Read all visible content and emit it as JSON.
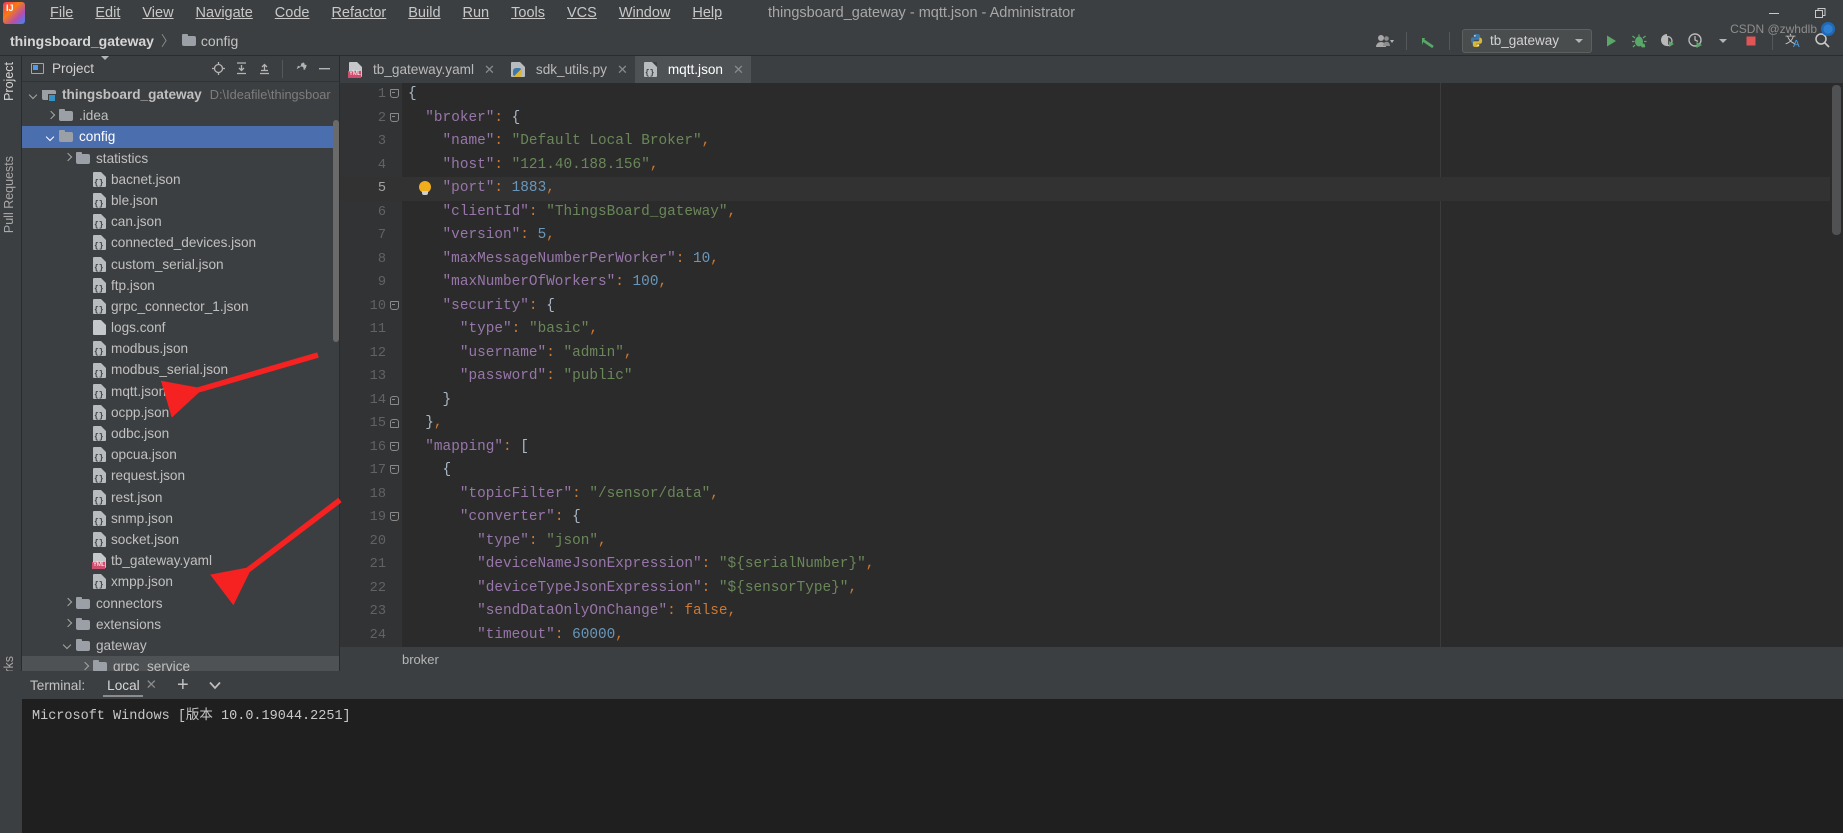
{
  "window": {
    "title": "thingsboard_gateway - mqtt.json - Administrator",
    "minimize": "—",
    "restore": "❐",
    "close": "✕"
  },
  "menubar": {
    "items": [
      "File",
      "Edit",
      "View",
      "Navigate",
      "Code",
      "Refactor",
      "Build",
      "Run",
      "Tools",
      "VCS",
      "Window",
      "Help"
    ]
  },
  "navbar": {
    "breadcrumb": {
      "root": "thingsboard_gateway",
      "separator": "〉",
      "item": "config"
    },
    "run_config": {
      "label": "tb_gateway"
    },
    "icons": {
      "people": "people-icon",
      "updates": "update-project-icon",
      "run": "run-icon",
      "debug": "debug-icon",
      "coverage": "run-with-coverage-icon",
      "profile": "profiler-icon",
      "stop": "stop-icon",
      "translate": "translate-icon",
      "search": "search-everywhere-icon"
    }
  },
  "left_strip": {
    "tabs": [
      "Project",
      "Pull Requests",
      "Bookmarks"
    ]
  },
  "project_panel": {
    "header": {
      "title": "Project",
      "dropdown": "▾"
    },
    "actions": [
      "select-opened-file",
      "expand-all",
      "collapse-all",
      "settings",
      "hide"
    ],
    "tree": [
      {
        "label": "thingsboard_gateway",
        "detail": "D:\\Ideafile\\thingsboar",
        "icon": "module",
        "indent": 0,
        "arrow": "open",
        "bold": true
      },
      {
        "label": ".idea",
        "icon": "folder",
        "indent": 1,
        "arrow": "closed"
      },
      {
        "label": "config",
        "icon": "folder",
        "indent": 1,
        "arrow": "open",
        "selected": true
      },
      {
        "label": "statistics",
        "icon": "folder",
        "indent": 2,
        "arrow": "closed"
      },
      {
        "label": "bacnet.json",
        "icon": "json",
        "indent": 3
      },
      {
        "label": "ble.json",
        "icon": "json",
        "indent": 3
      },
      {
        "label": "can.json",
        "icon": "json",
        "indent": 3
      },
      {
        "label": "connected_devices.json",
        "icon": "json",
        "indent": 3
      },
      {
        "label": "custom_serial.json",
        "icon": "json",
        "indent": 3
      },
      {
        "label": "ftp.json",
        "icon": "json",
        "indent": 3
      },
      {
        "label": "grpc_connector_1.json",
        "icon": "json",
        "indent": 3
      },
      {
        "label": "logs.conf",
        "icon": "conf",
        "indent": 3
      },
      {
        "label": "modbus.json",
        "icon": "json",
        "indent": 3
      },
      {
        "label": "modbus_serial.json",
        "icon": "json",
        "indent": 3
      },
      {
        "label": "mqtt.json",
        "icon": "json",
        "indent": 3
      },
      {
        "label": "ocpp.json",
        "icon": "json",
        "indent": 3
      },
      {
        "label": "odbc.json",
        "icon": "json",
        "indent": 3
      },
      {
        "label": "opcua.json",
        "icon": "json",
        "indent": 3
      },
      {
        "label": "request.json",
        "icon": "json",
        "indent": 3
      },
      {
        "label": "rest.json",
        "icon": "json",
        "indent": 3
      },
      {
        "label": "snmp.json",
        "icon": "json",
        "indent": 3
      },
      {
        "label": "socket.json",
        "icon": "json",
        "indent": 3
      },
      {
        "label": "tb_gateway.yaml",
        "icon": "yaml",
        "indent": 3
      },
      {
        "label": "xmpp.json",
        "icon": "json",
        "indent": 3
      },
      {
        "label": "connectors",
        "icon": "folder",
        "indent": 2,
        "arrow": "closed"
      },
      {
        "label": "extensions",
        "icon": "folder",
        "indent": 2,
        "arrow": "closed"
      },
      {
        "label": "gateway",
        "icon": "folder",
        "indent": 2,
        "arrow": "open"
      },
      {
        "label": "grpc_service",
        "icon": "folder",
        "indent": 3,
        "arrow": "closed",
        "hover": true
      }
    ]
  },
  "editor_tabs": [
    {
      "label": "tb_gateway.yaml",
      "icon": "yaml",
      "active": false,
      "close": "✕"
    },
    {
      "label": "sdk_utils.py",
      "icon": "python",
      "active": false,
      "close": "✕"
    },
    {
      "label": "mqtt.json",
      "icon": "json",
      "active": true,
      "close": "✕"
    }
  ],
  "editor": {
    "breadcrumb": "broker",
    "current_line": 5,
    "lines": [
      {
        "n": 1,
        "fold": "dn",
        "segs": [
          {
            "t": "{",
            "c": "brk"
          }
        ]
      },
      {
        "n": 2,
        "fold": "dn",
        "segs": [
          {
            "t": "  ",
            "c": "brk"
          },
          {
            "t": "\"broker\"",
            "c": "key"
          },
          {
            "t": ": ",
            "c": "pun"
          },
          {
            "t": "{",
            "c": "brk"
          }
        ]
      },
      {
        "n": 3,
        "segs": [
          {
            "t": "    ",
            "c": "brk"
          },
          {
            "t": "\"name\"",
            "c": "key"
          },
          {
            "t": ": ",
            "c": "pun"
          },
          {
            "t": "\"Default Local Broker\"",
            "c": "str"
          },
          {
            "t": ",",
            "c": "pun"
          }
        ]
      },
      {
        "n": 4,
        "segs": [
          {
            "t": "    ",
            "c": "brk"
          },
          {
            "t": "\"host\"",
            "c": "key"
          },
          {
            "t": ": ",
            "c": "pun"
          },
          {
            "t": "\"121.40.188.156\"",
            "c": "str"
          },
          {
            "t": ",",
            "c": "pun"
          }
        ]
      },
      {
        "n": 5,
        "bulb": true,
        "current": true,
        "segs": [
          {
            "t": "    ",
            "c": "brk"
          },
          {
            "t": "\"port\"",
            "c": "key"
          },
          {
            "t": ": ",
            "c": "pun"
          },
          {
            "t": "1883",
            "c": "num"
          },
          {
            "t": ",",
            "c": "pun"
          }
        ]
      },
      {
        "n": 6,
        "segs": [
          {
            "t": "    ",
            "c": "brk"
          },
          {
            "t": "\"clientId\"",
            "c": "key"
          },
          {
            "t": ": ",
            "c": "pun"
          },
          {
            "t": "\"ThingsBoard_gateway\"",
            "c": "str"
          },
          {
            "t": ",",
            "c": "pun"
          }
        ]
      },
      {
        "n": 7,
        "segs": [
          {
            "t": "    ",
            "c": "brk"
          },
          {
            "t": "\"version\"",
            "c": "key"
          },
          {
            "t": ": ",
            "c": "pun"
          },
          {
            "t": "5",
            "c": "num"
          },
          {
            "t": ",",
            "c": "pun"
          }
        ]
      },
      {
        "n": 8,
        "segs": [
          {
            "t": "    ",
            "c": "brk"
          },
          {
            "t": "\"maxMessageNumberPerWorker\"",
            "c": "key"
          },
          {
            "t": ": ",
            "c": "pun"
          },
          {
            "t": "10",
            "c": "num"
          },
          {
            "t": ",",
            "c": "pun"
          }
        ]
      },
      {
        "n": 9,
        "segs": [
          {
            "t": "    ",
            "c": "brk"
          },
          {
            "t": "\"maxNumberOfWorkers\"",
            "c": "key"
          },
          {
            "t": ": ",
            "c": "pun"
          },
          {
            "t": "100",
            "c": "num"
          },
          {
            "t": ",",
            "c": "pun"
          }
        ]
      },
      {
        "n": 10,
        "fold": "dn",
        "segs": [
          {
            "t": "    ",
            "c": "brk"
          },
          {
            "t": "\"security\"",
            "c": "key"
          },
          {
            "t": ": ",
            "c": "pun"
          },
          {
            "t": "{",
            "c": "brk"
          }
        ]
      },
      {
        "n": 11,
        "segs": [
          {
            "t": "      ",
            "c": "brk"
          },
          {
            "t": "\"type\"",
            "c": "key"
          },
          {
            "t": ": ",
            "c": "pun"
          },
          {
            "t": "\"basic\"",
            "c": "str"
          },
          {
            "t": ",",
            "c": "pun"
          }
        ]
      },
      {
        "n": 12,
        "segs": [
          {
            "t": "      ",
            "c": "brk"
          },
          {
            "t": "\"username\"",
            "c": "key"
          },
          {
            "t": ": ",
            "c": "pun"
          },
          {
            "t": "\"admin\"",
            "c": "str"
          },
          {
            "t": ",",
            "c": "pun"
          }
        ]
      },
      {
        "n": 13,
        "segs": [
          {
            "t": "      ",
            "c": "brk"
          },
          {
            "t": "\"password\"",
            "c": "key"
          },
          {
            "t": ": ",
            "c": "pun"
          },
          {
            "t": "\"public\"",
            "c": "str"
          }
        ]
      },
      {
        "n": 14,
        "fold": "up",
        "segs": [
          {
            "t": "    ",
            "c": "brk"
          },
          {
            "t": "}",
            "c": "brk"
          }
        ]
      },
      {
        "n": 15,
        "fold": "up",
        "segs": [
          {
            "t": "  ",
            "c": "brk"
          },
          {
            "t": "}",
            "c": "brk"
          },
          {
            "t": ",",
            "c": "pun"
          }
        ]
      },
      {
        "n": 16,
        "fold": "dn",
        "segs": [
          {
            "t": "  ",
            "c": "brk"
          },
          {
            "t": "\"mapping\"",
            "c": "key"
          },
          {
            "t": ": ",
            "c": "pun"
          },
          {
            "t": "[",
            "c": "brk"
          }
        ]
      },
      {
        "n": 17,
        "fold": "dn",
        "segs": [
          {
            "t": "    ",
            "c": "brk"
          },
          {
            "t": "{",
            "c": "brk"
          }
        ]
      },
      {
        "n": 18,
        "segs": [
          {
            "t": "      ",
            "c": "brk"
          },
          {
            "t": "\"topicFilter\"",
            "c": "key"
          },
          {
            "t": ": ",
            "c": "pun"
          },
          {
            "t": "\"/sensor/data\"",
            "c": "str"
          },
          {
            "t": ",",
            "c": "pun"
          }
        ]
      },
      {
        "n": 19,
        "fold": "dn",
        "segs": [
          {
            "t": "      ",
            "c": "brk"
          },
          {
            "t": "\"converter\"",
            "c": "key"
          },
          {
            "t": ": ",
            "c": "pun"
          },
          {
            "t": "{",
            "c": "brk"
          }
        ]
      },
      {
        "n": 20,
        "segs": [
          {
            "t": "        ",
            "c": "brk"
          },
          {
            "t": "\"type\"",
            "c": "key"
          },
          {
            "t": ": ",
            "c": "pun"
          },
          {
            "t": "\"json\"",
            "c": "str"
          },
          {
            "t": ",",
            "c": "pun"
          }
        ]
      },
      {
        "n": 21,
        "segs": [
          {
            "t": "        ",
            "c": "brk"
          },
          {
            "t": "\"deviceNameJsonExpression\"",
            "c": "key"
          },
          {
            "t": ": ",
            "c": "pun"
          },
          {
            "t": "\"${serialNumber}\"",
            "c": "str"
          },
          {
            "t": ",",
            "c": "pun"
          }
        ]
      },
      {
        "n": 22,
        "segs": [
          {
            "t": "        ",
            "c": "brk"
          },
          {
            "t": "\"deviceTypeJsonExpression\"",
            "c": "key"
          },
          {
            "t": ": ",
            "c": "pun"
          },
          {
            "t": "\"${sensorType}\"",
            "c": "str"
          },
          {
            "t": ",",
            "c": "pun"
          }
        ]
      },
      {
        "n": 23,
        "segs": [
          {
            "t": "        ",
            "c": "brk"
          },
          {
            "t": "\"sendDataOnlyOnChange\"",
            "c": "key"
          },
          {
            "t": ": ",
            "c": "pun"
          },
          {
            "t": "false",
            "c": "kw"
          },
          {
            "t": ",",
            "c": "pun"
          }
        ]
      },
      {
        "n": 24,
        "segs": [
          {
            "t": "        ",
            "c": "brk"
          },
          {
            "t": "\"timeout\"",
            "c": "key"
          },
          {
            "t": ": ",
            "c": "pun"
          },
          {
            "t": "60000",
            "c": "num"
          },
          {
            "t": ",",
            "c": "pun"
          }
        ]
      }
    ]
  },
  "terminal": {
    "label": "Terminal:",
    "tab": "Local",
    "close": "✕",
    "add": "+",
    "dropdown": "▾",
    "output": "Microsoft Windows [版本 10.0.19044.2251]"
  },
  "watermark": {
    "text": "CSDN @zwhdlb"
  }
}
